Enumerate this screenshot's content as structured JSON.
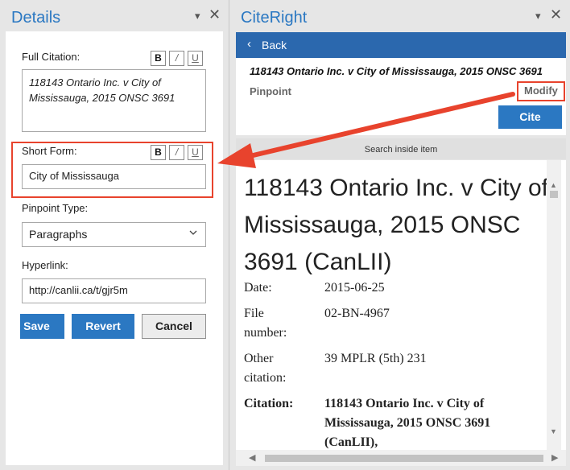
{
  "details_pane": {
    "title": "Details",
    "menu_glyph": "▾",
    "close_glyph": "✕",
    "full_citation": {
      "label": "Full Citation:",
      "value": "118143 Ontario Inc. v City of Mississauga, 2015 ONSC 3691"
    },
    "short_form": {
      "label": "Short Form:",
      "value": "City of Mississauga"
    },
    "format_buttons": {
      "bold": "B",
      "italic": "/",
      "underline": "U"
    },
    "pinpoint_type": {
      "label": "Pinpoint Type:",
      "value": "Paragraphs"
    },
    "hyperlink": {
      "label": "Hyperlink:",
      "value": "http://canlii.ca/t/gjr5m"
    },
    "buttons": {
      "save": "Save",
      "revert": "Revert",
      "cancel": "Cancel"
    }
  },
  "cite_pane": {
    "title": "CiteRight",
    "menu_glyph": "▾",
    "close_glyph": "✕",
    "back_label": "Back",
    "back_glyph": "‹",
    "item_title": "118143 Ontario Inc. v City of Mississauga, 2015 ONSC 3691",
    "pinpoint_label": "Pinpoint",
    "modify_label": "Modify",
    "cite_label": "Cite",
    "search_label": "Search inside item",
    "document": {
      "heading": "118143 Ontario Inc. v City of Mississauga, 2015 ONSC 3691 (CanLII)",
      "date_label": "Date:",
      "date_value": "2015-06-25",
      "file_label_line1": "File",
      "file_label_line2": "number:",
      "file_value": "02-BN-4967",
      "other_label_line1": "Other",
      "other_label_line2": "citation:",
      "other_value": "39 MPLR (5th) 231",
      "citation_label": "Citation:",
      "citation_line1": "118143 Ontario Inc. v City of",
      "citation_line2": "Mississauga, 2015 ONSC 3691",
      "citation_line3": "(CanLII),"
    },
    "scroll_glyphs": {
      "up": "▲",
      "down": "▼",
      "left": "◀",
      "right": "▶"
    }
  },
  "colors": {
    "accent_blue": "#2b78c2",
    "header_blue": "#2b68ae",
    "highlight_red": "#e8432d"
  },
  "icons": [
    "dropdown-chevron-icon",
    "back-chevron-icon",
    "close-icon",
    "pane-menu-icon",
    "red-arrow-annotation"
  ]
}
